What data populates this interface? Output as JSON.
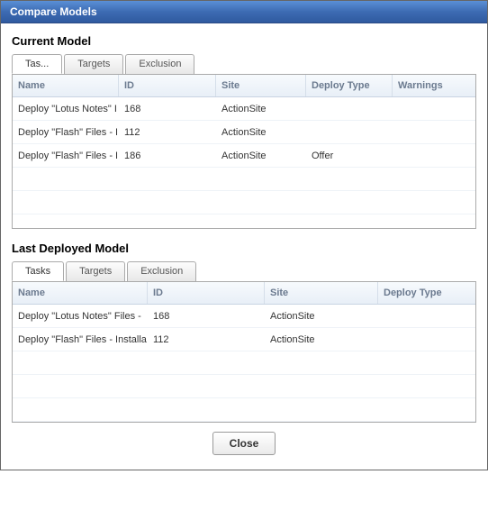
{
  "dialog": {
    "title": "Compare Models"
  },
  "current": {
    "title": "Current Model",
    "tabs": [
      {
        "label": "Tas..."
      },
      {
        "label": "Targets"
      },
      {
        "label": "Exclusion"
      }
    ],
    "columns": {
      "name": "Name",
      "id": "ID",
      "site": "Site",
      "deploy": "Deploy Type",
      "warnings": "Warnings"
    },
    "rows": [
      {
        "name": "Deploy \"Lotus Notes\" I",
        "id": "168",
        "site": "ActionSite",
        "deploy": "",
        "warnings": ""
      },
      {
        "name": "Deploy \"Flash\" Files - I",
        "id": "112",
        "site": "ActionSite",
        "deploy": "",
        "warnings": ""
      },
      {
        "name": "Deploy \"Flash\" Files - I",
        "id": "186",
        "site": "ActionSite",
        "deploy": "Offer",
        "warnings": ""
      }
    ]
  },
  "last": {
    "title": "Last Deployed Model",
    "tabs": [
      {
        "label": "Tasks"
      },
      {
        "label": "Targets"
      },
      {
        "label": "Exclusion"
      }
    ],
    "columns": {
      "name": "Name",
      "id": "ID",
      "site": "Site",
      "deploy": "Deploy Type"
    },
    "rows": [
      {
        "name": "Deploy \"Lotus Notes\" Files -",
        "id": "168",
        "site": "ActionSite",
        "deploy": ""
      },
      {
        "name": "Deploy \"Flash\" Files - Installa",
        "id": "112",
        "site": "ActionSite",
        "deploy": ""
      }
    ]
  },
  "buttons": {
    "close": "Close"
  }
}
